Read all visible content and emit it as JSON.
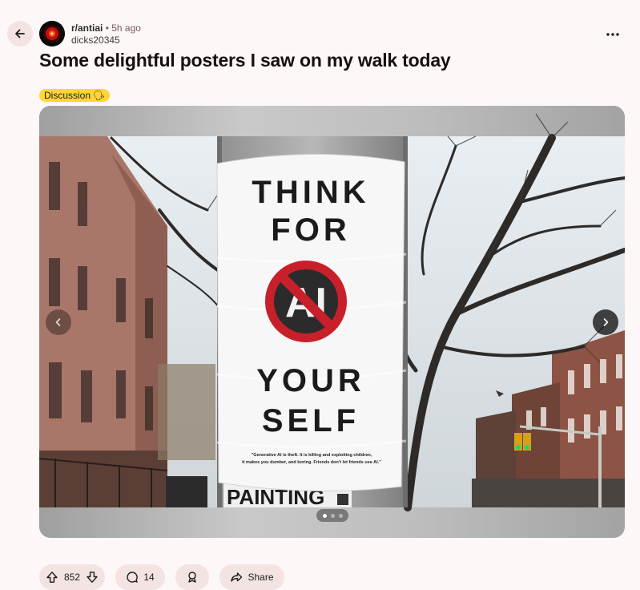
{
  "post": {
    "subreddit": "r/antiai",
    "separator": "•",
    "time_ago": "5h ago",
    "author": "dicks20345",
    "title": "Some delightful posters I saw on my walk today",
    "flair": {
      "label": "Discussion",
      "emoji": "🗣",
      "color": "#ffd635"
    }
  },
  "gallery": {
    "poster": {
      "line1": "THINK",
      "line2": "FOR",
      "symbol_text": "AI",
      "line3": "YOUR",
      "line4": "SELF",
      "fine_print_1": "\"Generative AI is theft. It is killing and exploiting children,",
      "fine_print_2": "it makes you dumber, and boring. Friends don't let friends use AI.\""
    },
    "sign_text": "PAINTING",
    "slide_count": 3,
    "active_slide": 1
  },
  "actions": {
    "upvotes": "852",
    "comments": "14",
    "share_label": "Share"
  },
  "colors": {
    "background": "#fdf7f7",
    "pill_bg": "#f3e3e3",
    "prohibition_red": "#c8202a"
  },
  "icons": [
    "back-arrow-icon",
    "subreddit-avatar-icon",
    "more-options-icon",
    "chevron-left-icon",
    "chevron-right-icon",
    "upvote-icon",
    "downvote-icon",
    "comment-icon",
    "award-icon",
    "share-icon"
  ]
}
